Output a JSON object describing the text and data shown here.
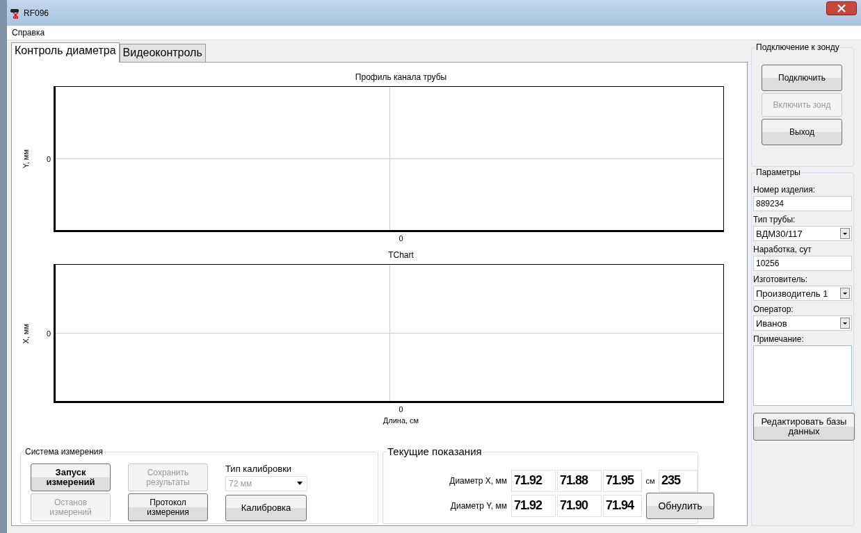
{
  "window": {
    "title": "RF096"
  },
  "menu": [
    "Справка"
  ],
  "tabs": [
    {
      "label": "Контроль диаметра",
      "selected": true
    },
    {
      "label": "Видеоконтроль",
      "selected": false
    }
  ],
  "charts": [
    {
      "title": "Профиль канала трубы",
      "ylabel": "Y, мм",
      "y_tick": "0",
      "x_tick": "0"
    },
    {
      "title": "TChart",
      "ylabel": "X, мм",
      "y_tick": "0",
      "x_tick": "0",
      "xlabel": "Длина, см"
    }
  ],
  "measurement_system": {
    "title": "Система измерения",
    "buttons": [
      {
        "label": "Запуск измерений",
        "disabled": false,
        "default": true
      },
      {
        "label": "Останов измерений",
        "disabled": true,
        "default": false
      },
      {
        "label": "Сохранить результаты",
        "disabled": true,
        "default": false
      },
      {
        "label": "Протокол измерения",
        "disabled": false,
        "default": false
      }
    ],
    "calibration": {
      "label": "Тип калибровки",
      "value": "72 мм",
      "disabled": true
    },
    "calibrate_button": {
      "label": "Калибровка",
      "disabled": false
    }
  },
  "current_readings": {
    "title": "Текущие показания",
    "rows": [
      {
        "label": "Диаметр X, мм",
        "values": [
          "71.92",
          "71.88",
          "71.95"
        ]
      },
      {
        "label": "Диаметр Y, мм",
        "values": [
          "71.92",
          "71.90",
          "71.94"
        ]
      }
    ],
    "unit": "см",
    "length": "235",
    "reset_button": "Обнулить"
  },
  "connection": {
    "title": "Подключение к зонду",
    "buttons": [
      {
        "label": "Подключить",
        "disabled": false
      },
      {
        "label": "Включить зонд",
        "disabled": true
      },
      {
        "label": "Выход",
        "disabled": false
      }
    ]
  },
  "parameters": {
    "title": "Параметры",
    "fields": [
      {
        "kind": "text",
        "label": "Номер изделия:",
        "value": "889234"
      },
      {
        "kind": "combo",
        "label": "Тип трубы:",
        "value": "ВДМ30/117"
      },
      {
        "kind": "text",
        "label": "Наработка, сут",
        "value": "10256"
      },
      {
        "kind": "combo",
        "label": "Изготовитель:",
        "value": "Производитель 1"
      },
      {
        "kind": "combo",
        "label": "Оператор:",
        "value": "Иванов"
      },
      {
        "kind": "memo",
        "label": "Примечание:"
      }
    ],
    "edit_button": "Редактировать базы данных"
  }
}
